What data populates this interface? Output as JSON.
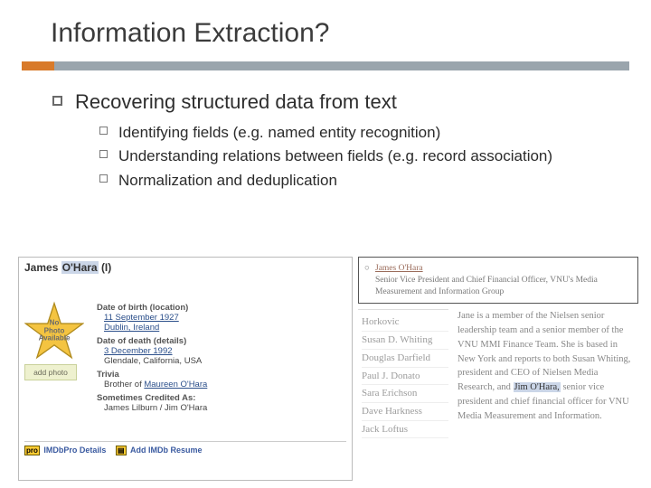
{
  "title": "Information Extraction?",
  "lvl1": "Recovering structured data from text",
  "lvl2": [
    "Identifying fields (e.g. named entity recognition)",
    "Understanding relations between fields (e.g. record association)",
    "Normalization and deduplication"
  ],
  "imdb": {
    "name_prefix": "James",
    "name_hl": "O'Hara",
    "name_suffix": "(I)",
    "no_photo": "No Photo\nAvailable",
    "add_photo": "add photo",
    "dob_lbl": "Date of birth (location)",
    "dob_date": "11 September 1927",
    "dob_place": "Dublin, Ireland",
    "dod_lbl": "Date of death (details)",
    "dod_date": "3 December 1992",
    "dod_place": "Glendale, California, USA",
    "trivia_lbl": "Trivia",
    "trivia_text_a": "Brother of ",
    "trivia_link": "Maureen O'Hara",
    "aka_lbl": "Sometimes Credited As:",
    "aka_text": "James Lilburn / Jim O'Hara",
    "footer_pro": "IMDbPro Details",
    "footer_resume": "Add IMDb Resume"
  },
  "role": {
    "name": "James O'Hara",
    "desc": "Senior Vice President and Chief Financial Officer, VNU's Media Measurement and Information Group"
  },
  "people": [
    "Horkovic",
    "Susan D. Whiting",
    "Douglas Darfield",
    "Paul J. Donato",
    "Sara Erichson",
    "Dave Harkness",
    "Jack Loftus"
  ],
  "bio": {
    "a": "Jane is a member of the Nielsen senior leadership team and a senior member of the VNU MMI Finance Team. She is based in New York and reports to both Susan Whiting, president and CEO of Nielsen Media Research, and ",
    "hl": "Jim O'Hara,",
    "b": " senior vice president and chief financial officer for VNU Media Measurement and Information."
  }
}
